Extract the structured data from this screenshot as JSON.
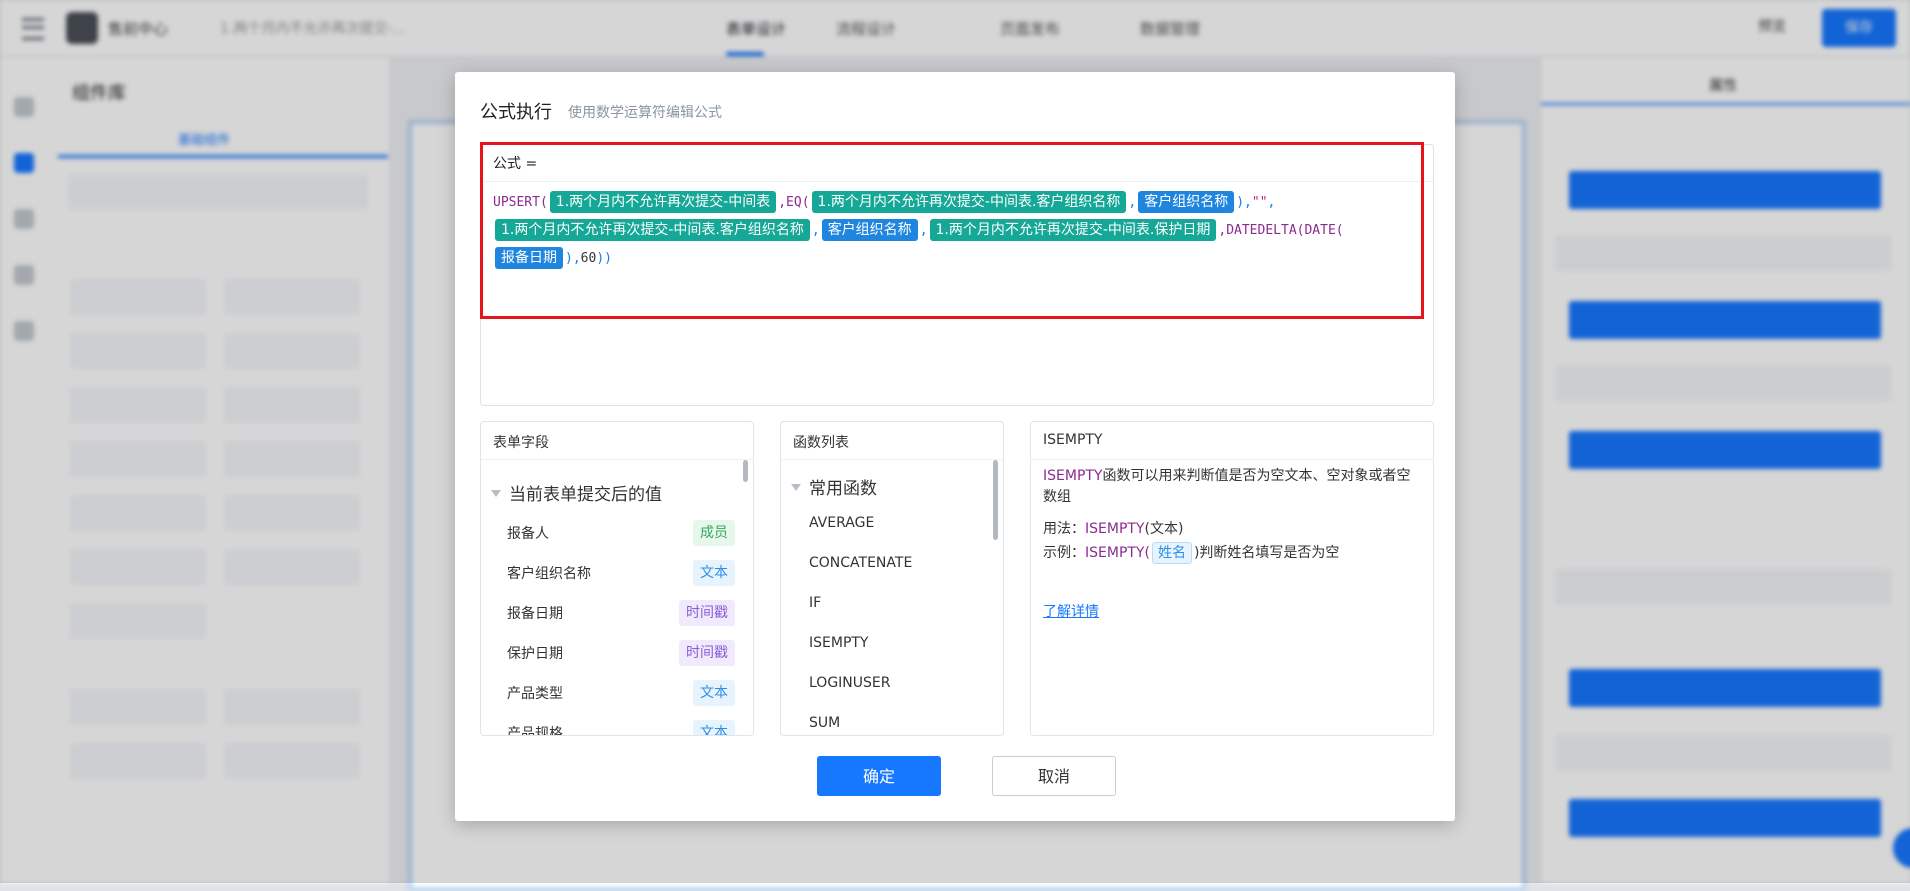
{
  "background": {
    "app_name": "售前中心",
    "form_name": "1.两个月内不允许再次提交-…",
    "nav": [
      "表单设计",
      "流程设计",
      "页面发布",
      "数据管理"
    ],
    "preview": "预览",
    "publish": "保存",
    "left_panel_title": "组件库",
    "left_panel_tab": "基础组件",
    "right_panel_tab": "属性"
  },
  "dialog": {
    "title": "公式执行",
    "subtitle": "使用数学运算符编辑公式",
    "formula_label": "公式 =",
    "formula": {
      "line1": {
        "upsert": "UPSERT(",
        "tag1": "1.两个月内不允许再次提交-中间表",
        "eq": ",EQ(",
        "tag2": "1.两个月内不允许再次提交-中间表.客户组织名称",
        "comma1": ",",
        "tag3": "客户组织名称",
        "close1": "),",
        "str": "\"\"",
        "comma2": ","
      },
      "line2": {
        "tag4": "1.两个月内不允许再次提交-中间表.客户组织名称",
        "comma3": ",",
        "tag5": "客户组织名称",
        "comma4": ",",
        "tag6": "1.两个月内不允许再次提交-中间表.保护日期",
        "datedelta": ",DATEDELTA(DATE("
      },
      "line3": {
        "tag7": "报备日期",
        "close2": "),",
        "num": "60",
        "close3": "))"
      }
    },
    "form_fields": {
      "title": "表单字段",
      "group": "当前表单提交后的值",
      "items": [
        {
          "name": "报备人",
          "type": "成员"
        },
        {
          "name": "客户组织名称",
          "type": "文本"
        },
        {
          "name": "报备日期",
          "type": "时间戳"
        },
        {
          "name": "保护日期",
          "type": "时间戳"
        },
        {
          "name": "产品类型",
          "type": "文本"
        },
        {
          "name": "产品规格",
          "type": "文本"
        }
      ]
    },
    "functions": {
      "title": "函数列表",
      "group": "常用函数",
      "items": [
        "AVERAGE",
        "CONCATENATE",
        "IF",
        "ISEMPTY",
        "LOGINUSER",
        "SUM"
      ]
    },
    "help": {
      "title": "ISEMPTY",
      "desc_fn": "ISEMPTY",
      "desc_text": "函数可以用来判断值是否为空文本、空对象或者空数组",
      "usage_label": "用法：",
      "usage_fn": "ISEMPTY",
      "usage_arg": "(文本)",
      "example_label": "示例：",
      "example_fn": "ISEMPTY(",
      "example_chip": "姓名",
      "example_tail": ")判断姓名填写是否为空",
      "link": "了解详情"
    },
    "ok_label": "确定",
    "cancel_label": "取消"
  }
}
